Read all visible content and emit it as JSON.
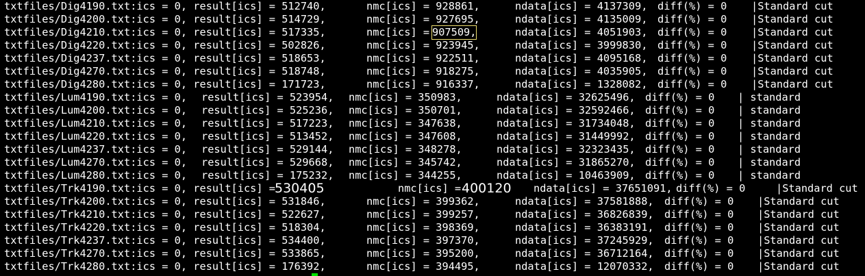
{
  "terminal": {
    "lines": [
      {
        "file": "txtfiles/Dig4190.txt:ics = 0, result[ics] = 512740,",
        "nmc": "nmc[ics] = 928861,",
        "ndata": "ndata[ics] = 4137309,",
        "diff": "diff(%) = 0",
        "tag": "|Standard cut"
      },
      {
        "file": "txtfiles/Dig4200.txt:ics = 0, result[ics] = 514729,",
        "nmc": "nmc[ics] = 927695,",
        "ndata": "ndata[ics] = 4135009,",
        "diff": "diff(%) = 0",
        "tag": "|Standard cut"
      },
      {
        "file": "txtfiles/Dig4210.txt:ics = 0, result[ics] = 517335,",
        "nmc_label": "nmc[ics] =",
        "nmc_value": "907509,",
        "ndata": "ndata[ics] = 4051903,",
        "diff": "diff(%) = 0",
        "tag": "|Standard cut"
      },
      {
        "file": "txtfiles/Dig4220.txt:ics = 0, result[ics] = 502826,",
        "nmc": "nmc[ics] = 923945,",
        "ndata": "ndata[ics] = 3999830,",
        "diff": "diff(%) = 0",
        "tag": "|Standard cut"
      },
      {
        "file": "txtfiles/Dig4237.txt:ics = 0, result[ics] = 518653,",
        "nmc": "nmc[ics] = 922511,",
        "ndata": "ndata[ics] = 4095168,",
        "diff": "diff(%) = 0",
        "tag": "|Standard cut"
      },
      {
        "file": "txtfiles/Dig4270.txt:ics = 0, result[ics] = 518748,",
        "nmc": "nmc[ics] = 918275,",
        "ndata": "ndata[ics] = 4035905,",
        "diff": "diff(%) = 0",
        "tag": "|Standard cut"
      },
      {
        "file": "txtfiles/Dig4280.txt:ics = 0, result[ics] = 171723,",
        "nmc": "nmc[ics] = 916337,",
        "ndata": "ndata[ics] = 1328082,",
        "diff": "diff(%) = 0",
        "tag": "|Standard cut"
      },
      {
        "file": "txtfiles/Lum4190.txt:ics = 0,",
        "result": "result[ics] = 523954,",
        "nmc": "nmc[ics] = 350983,",
        "ndata": "ndata[ics] = 32625496,",
        "diff": "diff(%) = 0",
        "tag": "| standard"
      },
      {
        "file": "txtfiles/Lum4200.txt:ics = 0,",
        "result": "result[ics] = 525236,",
        "nmc": "nmc[ics] = 350701,",
        "ndata": "ndata[ics] = 32592466,",
        "diff": "diff(%) = 0",
        "tag": "| standard"
      },
      {
        "file": "txtfiles/Lum4210.txt:ics = 0,",
        "result": "result[ics] = 517223,",
        "nmc": "nmc[ics] = 347638,",
        "ndata": "ndata[ics] = 31734048,",
        "diff": "diff(%) = 0",
        "tag": "| standard"
      },
      {
        "file": "txtfiles/Lum4220.txt:ics = 0,",
        "result": "result[ics] = 513452,",
        "nmc": "nmc[ics] = 347608,",
        "ndata": "ndata[ics] = 31449992,",
        "diff": "diff(%) = 0",
        "tag": "| standard"
      },
      {
        "file": "txtfiles/Lum4237.txt:ics = 0,",
        "result": "result[ics] = 529144,",
        "nmc": "nmc[ics] = 348278,",
        "ndata": "ndata[ics] = 32323435,",
        "diff": "diff(%) = 0",
        "tag": "| standard"
      },
      {
        "file": "txtfiles/Lum4270.txt:ics = 0,",
        "result": "result[ics] = 529668,",
        "nmc": "nmc[ics] = 345742,",
        "ndata": "ndata[ics] = 31865270,",
        "diff": "diff(%) = 0",
        "tag": "| standard"
      },
      {
        "file": "txtfiles/Lum4280.txt:ics = 0,",
        "result": "result[ics] = 175232,",
        "nmc": "nmc[ics] = 344255,",
        "ndata": "ndata[ics] = 10463909,",
        "diff": "diff(%) = 0",
        "tag": "| standard"
      },
      {
        "file": "txtfiles/Trk4190.txt:ics = 0, result[ics] =",
        "result_big": "530405",
        "nmc_label": "nmc[ics] =",
        "nmc_big": "400120",
        "ndata": "ndata[ics] = 37651091,",
        "diff": "diff(%) = 0",
        "tag": "|Standard cut"
      },
      {
        "file": "txtfiles/Trk4200.txt:ics = 0, result[ics] = 531846,",
        "nmc": "nmc[ics] = 399362,",
        "ndata": "ndata[ics] = 37581888,",
        "diff": "diff(%) = 0",
        "tag": "|Standard cut"
      },
      {
        "file": "txtfiles/Trk4210.txt:ics = 0, result[ics] = 522627,",
        "nmc": "nmc[ics] = 399257,",
        "ndata": "ndata[ics] = 36826839,",
        "diff": "diff(%) = 0",
        "tag": "|Standard cut"
      },
      {
        "file": "txtfiles/Trk4220.txt:ics = 0, result[ics] = 518304,",
        "nmc": "nmc[ics] = 398369,",
        "ndata": "ndata[ics] = 36383191,",
        "diff": "diff(%) = 0",
        "tag": "|Standard cut"
      },
      {
        "file": "txtfiles/Trk4237.txt:ics = 0, result[ics] = 534400,",
        "nmc": "nmc[ics] = 397370,",
        "ndata": "ndata[ics] = 37245929,",
        "diff": "diff(%) = 0",
        "tag": "|Standard cut"
      },
      {
        "file": "txtfiles/Trk4270.txt:ics = 0, result[ics] = 533865,",
        "nmc": "nmc[ics] = 395200,",
        "ndata": "ndata[ics] = 36712164,",
        "diff": "diff(%) = 0",
        "tag": "|Standard cut"
      },
      {
        "file": "txtfiles/Trk4280.txt:ics = 0, result[ics] = 176392,",
        "nmc": "nmc[ics] = 394495,",
        "ndata": "ndata[ics] = 12070332,",
        "diff": "diff(%) = 0",
        "tag": "|Standard cut"
      }
    ]
  },
  "colors": {
    "background": "#000000",
    "text": "#ffffff",
    "cursor": "#00e000",
    "selection_box": "#f0e070"
  }
}
